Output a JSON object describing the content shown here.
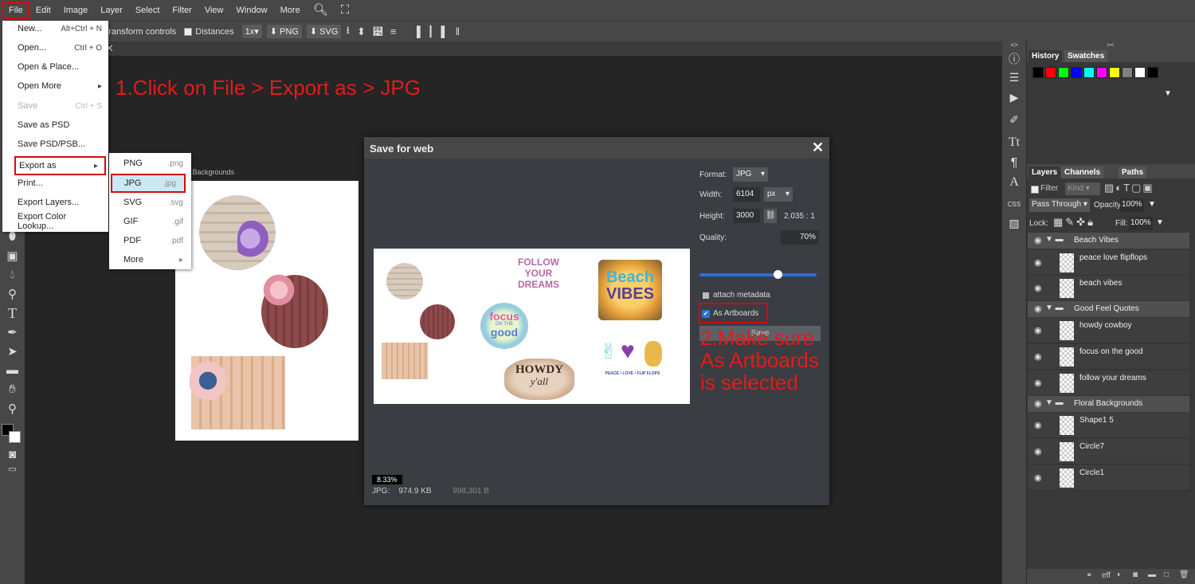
{
  "menubar": {
    "items": [
      "File",
      "Edit",
      "Image",
      "Layer",
      "Select",
      "Filter",
      "View",
      "Window",
      "More"
    ]
  },
  "options": {
    "transform": "Transform controls",
    "distances": "Distances",
    "scale": "1x",
    "png": "PNG",
    "svg": "SVG"
  },
  "file_menu": {
    "items": [
      {
        "label": "New...",
        "shortcut": "Alt+Ctrl + N"
      },
      {
        "label": "Open...",
        "shortcut": "Ctrl + O"
      },
      {
        "label": "Open & Place...",
        "shortcut": ""
      },
      {
        "label": "Open More",
        "shortcut": "▸"
      },
      {
        "label": "Save",
        "shortcut": "Ctrl + S"
      },
      {
        "label": "Save as PSD",
        "shortcut": ""
      },
      {
        "label": "Save PSD/PSB...",
        "shortcut": ""
      },
      {
        "label": "Export as",
        "shortcut": "▸"
      },
      {
        "label": "Print...",
        "shortcut": ""
      },
      {
        "label": "Export Layers...",
        "shortcut": ""
      },
      {
        "label": "Export Color Lookup...",
        "shortcut": ""
      }
    ]
  },
  "export_submenu": {
    "items": [
      {
        "label": "PNG",
        "ext": ".png"
      },
      {
        "label": "JPG",
        "ext": ".jpg"
      },
      {
        "label": "SVG",
        "ext": ".svg"
      },
      {
        "label": "GIF",
        "ext": ".gif"
      },
      {
        "label": "PDF",
        "ext": ".pdf"
      },
      {
        "label": "More",
        "ext": "▸"
      }
    ]
  },
  "annotations": {
    "step1": "1.Click on File > Export as > JPG",
    "step2_line1": "2.Make sure",
    "step2_line2": "As Artboards",
    "step2_line3": "is selected"
  },
  "canvas": {
    "artboard_label": "al Backgrounds"
  },
  "dialog": {
    "title": "Save for web",
    "format_label": "Format:",
    "format_value": "JPG",
    "width_label": "Width:",
    "width_value": "6104",
    "unit": "px",
    "height_label": "Height:",
    "height_value": "3000",
    "ratio": "2.035 : 1",
    "quality_label": "Quality:",
    "quality_value": "70%",
    "quality_fraction": 0.7,
    "attach_metadata": "attach metadata",
    "attach_metadata_checked": false,
    "as_artboards": "As Artboards",
    "as_artboards_checked": true,
    "save_label": "Save",
    "zoom": "8.33%",
    "file_type": "JPG:",
    "file_size": "974.9 KB",
    "file_bytes": "998,301 B",
    "preview_texts": {
      "follow": "FOLLOW YOUR DREAMS",
      "beach": "Beach",
      "vibes": "VIBES",
      "focus": "focus",
      "on_the": "ON THE",
      "good": "good",
      "howdy": "HOWDY",
      "yall": "y'all",
      "peace": "PEACE • LOVE • FLIP FLOPS"
    }
  },
  "history_panel": {
    "tabs": [
      "History",
      "Swatches"
    ],
    "swatches": [
      "#000000",
      "#ff0000",
      "#00ff00",
      "#0000ff",
      "#00ffff",
      "#ff00ff",
      "#ffff00",
      "#808080",
      "#ffffff",
      "#000000"
    ]
  },
  "layers_panel": {
    "tabs": [
      "Layers",
      "Channels",
      "Paths"
    ],
    "filter_label": "Filter",
    "kind_label": "Kind",
    "blend_mode": "Pass Through",
    "opacity_label": "Opacity:",
    "opacity_value": "100%",
    "lock_label": "Lock:",
    "fill_label": "Fill:",
    "fill_value": "100%",
    "groups": [
      {
        "name": "Beach Vibes",
        "layers": [
          "peace love flipflops",
          "beach vibes"
        ]
      },
      {
        "name": "Good Feel Quotes",
        "layers": [
          "howdy cowboy",
          "focus on the good",
          "follow your dreams"
        ]
      },
      {
        "name": "Floral Backgrounds",
        "layers": [
          "Shape1 5",
          "Circle7",
          "Circle1"
        ]
      }
    ],
    "footer_eff": "eff"
  },
  "right_strip": {
    "css_label": "CSS"
  },
  "colors": {
    "annotation_red": "#e21b1b",
    "highlight_red": "#d30c0c",
    "slider_blue": "#2d6de0"
  }
}
